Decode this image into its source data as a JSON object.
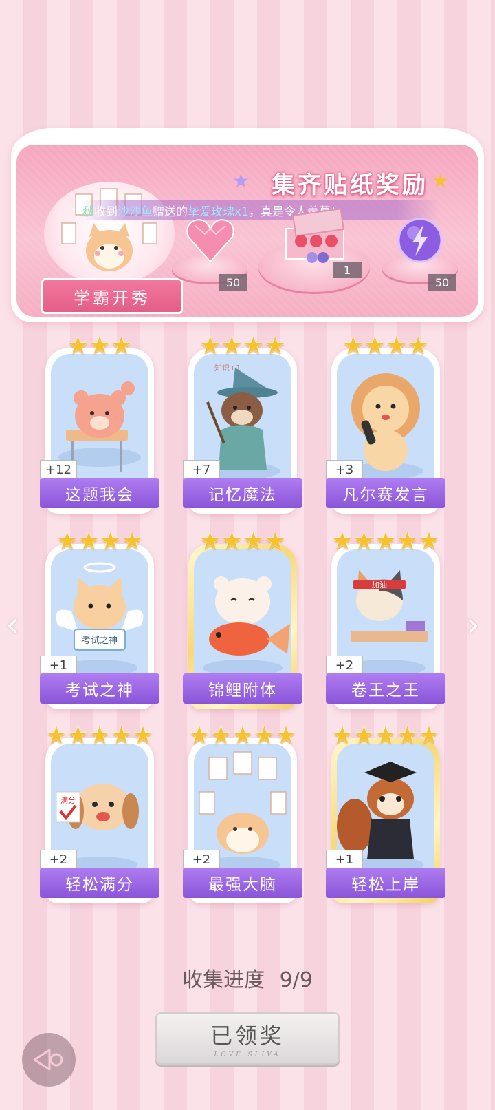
{
  "banner": {
    "title": "集齐贴纸奖励",
    "ticker_parts": [
      "秋",
      "收到",
      "沙沙鱼",
      "赠送的",
      "挚爱玫瑰x1",
      "，真是令人羡慕！"
    ],
    "sticker_ribbon": "学霸开秀",
    "rewards": [
      {
        "icon": "pink-heart-gem-icon",
        "count": "50"
      },
      {
        "icon": "gift-box-icon",
        "count": "1"
      },
      {
        "icon": "purple-lightning-orb-icon",
        "count": "50"
      }
    ]
  },
  "cards": [
    {
      "name": "这题我会",
      "count": "+12",
      "stars": 3,
      "character": "bear-at-desk",
      "gold": false
    },
    {
      "name": "记忆魔法",
      "count": "+7",
      "stars": 4,
      "character": "otter-wizard",
      "gold": false
    },
    {
      "name": "凡尔赛发言",
      "count": "+3",
      "stars": 4,
      "character": "lion-microphone",
      "gold": false
    },
    {
      "name": "考试之神",
      "count": "+1",
      "stars": 4,
      "character": "angel-cat",
      "gold": false
    },
    {
      "name": "锦鲤附体",
      "count": "",
      "stars": 4,
      "character": "bear-with-koi",
      "gold": true
    },
    {
      "name": "卷王之王",
      "count": "+2",
      "stars": 5,
      "character": "cat-studying",
      "gold": false
    },
    {
      "name": "轻松满分",
      "count": "+2",
      "stars": 5,
      "character": "puppy-full-score",
      "gold": false
    },
    {
      "name": "最强大脑",
      "count": "+2",
      "stars": 5,
      "character": "cat-with-papers",
      "gold": false
    },
    {
      "name": "轻松上岸",
      "count": "+1",
      "stars": 5,
      "character": "squirrel-graduate",
      "gold": true
    }
  ],
  "card_art_text": {
    "knowledge": "知识+1",
    "headband": "加油",
    "sign": "考试之神",
    "score": "满分"
  },
  "progress": {
    "label": "收集进度",
    "value": "9/9"
  },
  "claim_button": {
    "label": "已领奖",
    "sub": "LOVE SLIVA"
  },
  "colors": {
    "accent_purple": "#9a66e2",
    "star_gold": "#f6c22e",
    "banner_pink": "#f6a6bf"
  }
}
